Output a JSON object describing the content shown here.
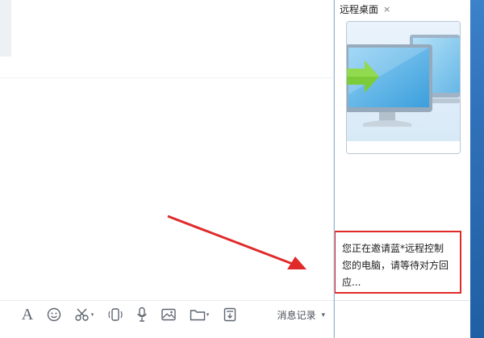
{
  "side_panel": {
    "tab_label": "远程桌面",
    "tab_close": "×",
    "notice": {
      "line1": "您正在邀请蓝*远程控制",
      "line2": "您的电脑，请等待对方回",
      "line3": "应..."
    }
  },
  "toolbar": {
    "font_glyph": "A",
    "history_label": "消息记录",
    "history_caret": "▾",
    "caret": "▾"
  },
  "icons": [
    "font-icon",
    "emoji-icon",
    "scissors-icon",
    "shake-icon",
    "microphone-icon",
    "image-icon",
    "folder-icon",
    "screenshot-icon",
    "remote-desktop-icon"
  ],
  "colors": {
    "highlight": "#e02a2a",
    "arrow": "#e02a2a",
    "accent": "#2e6fb6"
  }
}
